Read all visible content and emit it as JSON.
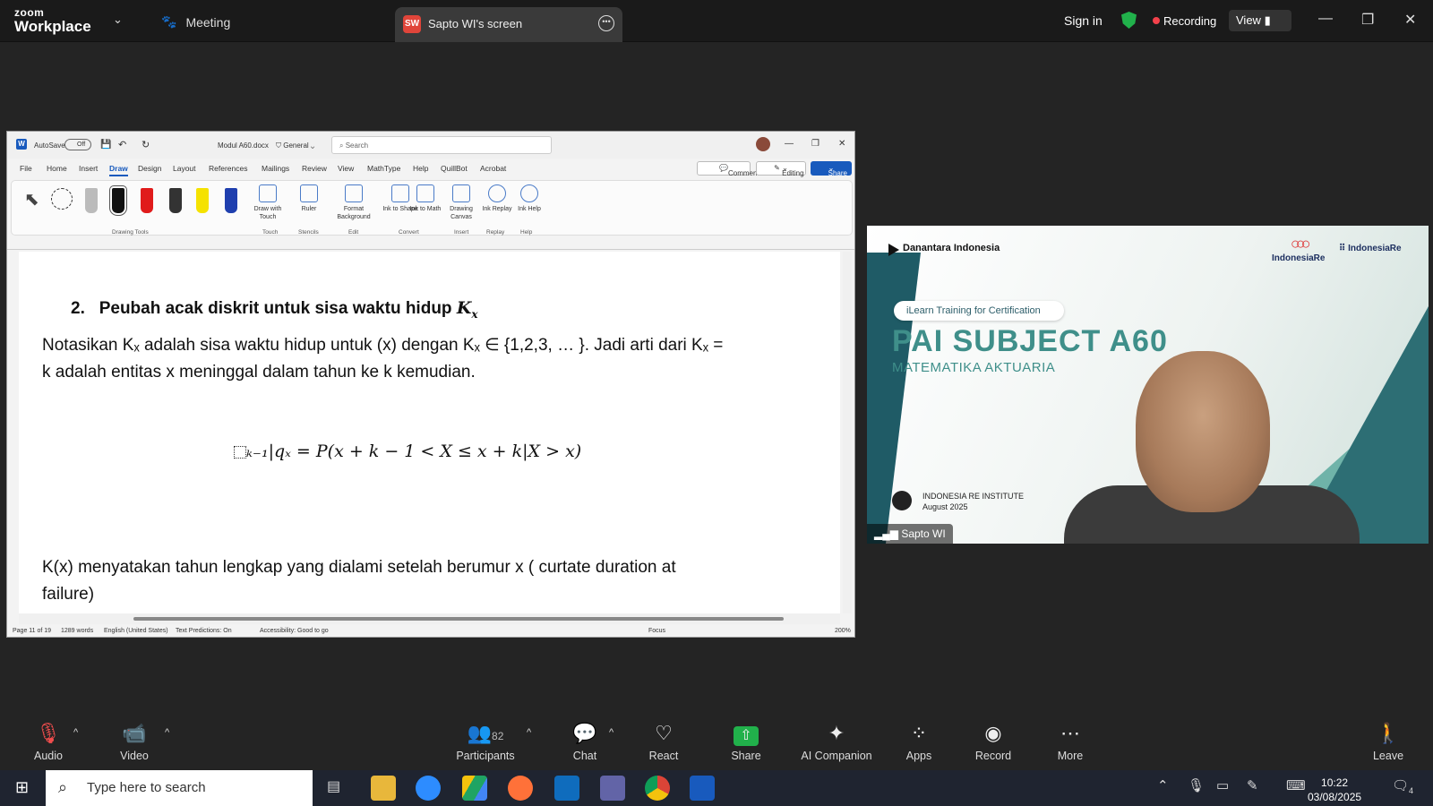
{
  "zoom": {
    "logo_line1": "zoom",
    "logo_line2": "Workplace",
    "meeting_label": "Meeting",
    "share_tab_initials": "SW",
    "share_tab_title": "Sapto WI's screen",
    "sign_in": "Sign in",
    "recording": "Recording",
    "view": "View"
  },
  "word": {
    "autosave": "AutoSave",
    "autosave_state": "Off",
    "doc_name": "Modul A60.docx",
    "sensitivity": "General",
    "search_placeholder": "Search",
    "menu": [
      "File",
      "Home",
      "Insert",
      "Draw",
      "Design",
      "Layout",
      "References",
      "Mailings",
      "Review",
      "View",
      "MathType",
      "Help",
      "QuillBot",
      "Acrobat"
    ],
    "comments": "Comments",
    "editing": "Editing",
    "share": "Share",
    "ribbon": [
      {
        "label": "Draw with Touch"
      },
      {
        "label": "Ruler"
      },
      {
        "label": "Format Background"
      },
      {
        "label": "Ink to Shape"
      },
      {
        "label": "Ink to Math"
      },
      {
        "label": "Drawing Canvas"
      },
      {
        "label": "Ink Replay"
      },
      {
        "label": "Ink Help"
      }
    ],
    "groups": [
      "Drawing Tools",
      "Touch",
      "Stencils",
      "Edit",
      "Convert",
      "Insert",
      "Replay",
      "Help"
    ],
    "doc": {
      "heading_num": "2.",
      "heading": "Peubah acak diskrit untuk sisa waktu hidup",
      "heading_var": "K",
      "heading_sub": "x",
      "para1_line1": "Notasikan Kₓ adalah sisa waktu hidup untuk (x) dengan Kₓ ∈ {1,2,3, … }. Jadi arti dari Kₓ =",
      "para1_line2": "k adalah entitas x meninggal dalam tahun ke k kemudian.",
      "formula": "ₖ₋₁|qₓ = P(x + k − 1 < X ≤ x + k|X > x)",
      "para2_line1": "K(x) menyatakan tahun lengkap yang dialami setelah berumur x ( curtate duration at",
      "para2_line2": "failure)"
    },
    "status": {
      "page": "Page 11 of 19",
      "words": "1289 words",
      "language": "English (United States)",
      "predictions": "Text Predictions: On",
      "accessibility": "Accessibility: Good to go",
      "focus": "Focus",
      "zoom": "200%"
    }
  },
  "video": {
    "logo_left": "Danantara Indonesia",
    "logo_mid": "IndonesiaRe",
    "logo_right": "IndonesiaRe",
    "pill": "iLearn Training for Certification",
    "title": "PAI SUBJECT A60",
    "subtitle": "MATEMATIKA AKTUARIA",
    "institute": "INDONESIA RE INSTITUTE",
    "date": "August 2025",
    "participant_name": "Sapto WI"
  },
  "toolbar": [
    {
      "label": "Audio"
    },
    {
      "label": "Video"
    },
    {
      "label": "Participants",
      "count": "82"
    },
    {
      "label": "Chat"
    },
    {
      "label": "React"
    },
    {
      "label": "Share"
    },
    {
      "label": "AI Companion"
    },
    {
      "label": "Apps"
    },
    {
      "label": "Record"
    },
    {
      "label": "More"
    },
    {
      "label": "Leave"
    }
  ],
  "taskbar": {
    "search_placeholder": "Type here to search",
    "time": "10:22",
    "date": "03/08/2025",
    "notif_count": "4"
  },
  "colors": {
    "recording": "#f3414b",
    "share_green": "#21b14b",
    "word_blue": "#185abd",
    "slide_teal": "#3f8f8a"
  }
}
